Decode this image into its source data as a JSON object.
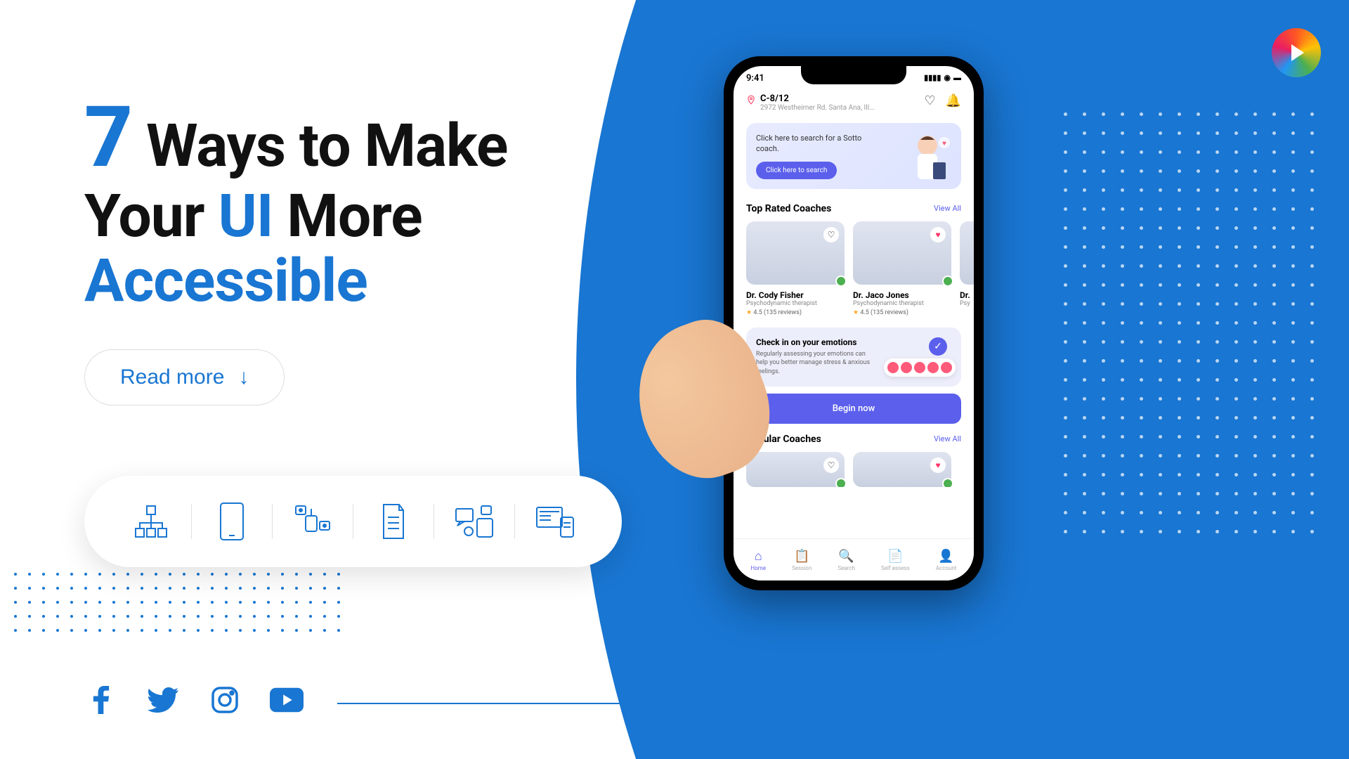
{
  "heading": {
    "number": "7",
    "line1_rest": "Ways to Make",
    "line2_pre": "Your",
    "line2_hl": "UI",
    "line2_post": "More",
    "line3": "Accessible"
  },
  "cta": {
    "label": "Read more",
    "arrow": "↓"
  },
  "socials": [
    "facebook",
    "twitter",
    "instagram",
    "youtube"
  ],
  "phone": {
    "time": "9:41",
    "location": {
      "code": "C-8/12",
      "address": "2972 Westheimer Rd. Santa Ana, Ill..."
    },
    "search_card": {
      "text": "Click here to search for a Sotto coach.",
      "button": "Click here to search"
    },
    "sections": {
      "top_rated": {
        "title": "Top Rated Coaches",
        "view_all": "View All"
      },
      "popular": {
        "title": "Popular Coaches",
        "view_all": "View All"
      }
    },
    "coaches": [
      {
        "name": "Dr. Cody Fisher",
        "role": "Psychodynamic therapist",
        "rating": "4.5 (135 reviews)",
        "fav": false
      },
      {
        "name": "Dr. Jaco Jones",
        "role": "Psychodynamic therapist",
        "rating": "4.5 (135 reviews)",
        "fav": true
      },
      {
        "name": "Dr.",
        "role": "Psy",
        "rating": "",
        "fav": false
      }
    ],
    "emotion": {
      "title": "Check in on your emotions",
      "text": "Regularly assessing your emotions can help you better manage stress & anxious feelings.",
      "button": "Begin now"
    },
    "nav": [
      {
        "label": "Home",
        "active": true
      },
      {
        "label": "Session",
        "active": false
      },
      {
        "label": "Search",
        "active": false
      },
      {
        "label": "Self assess",
        "active": false
      },
      {
        "label": "Account",
        "active": false
      }
    ]
  }
}
